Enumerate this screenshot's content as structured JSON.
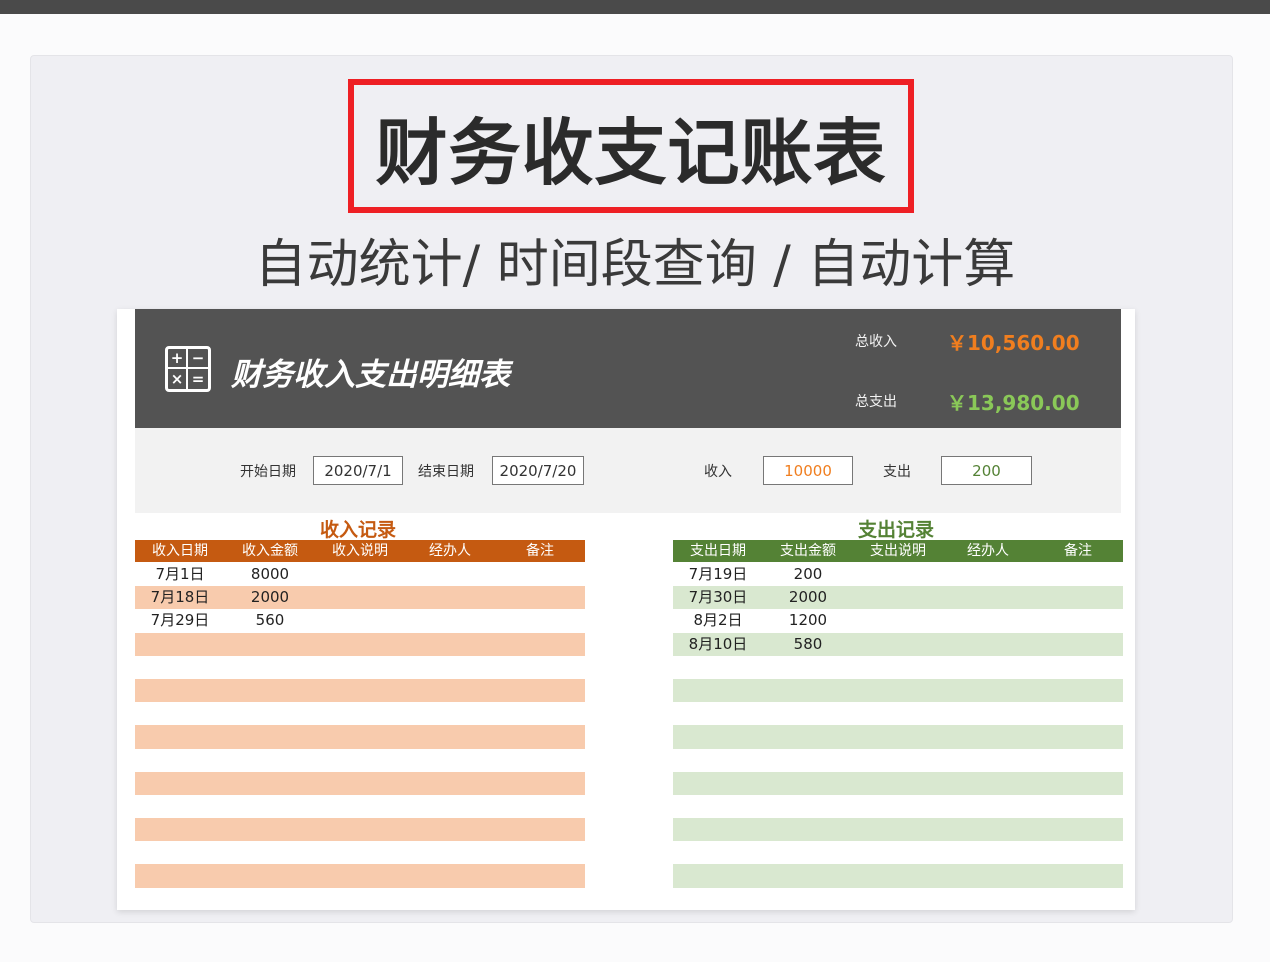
{
  "poster": {
    "title": "财务收支记账表",
    "subtitle": "自动统计/ 时间段查询 / 自动计算",
    "accent_red": "#ee1f24"
  },
  "sheet": {
    "title": "财务收入支出明细表",
    "icon": "calculator-icon",
    "calc_symbols": [
      "+",
      "−",
      "×",
      "="
    ],
    "summary": {
      "income_label": "总收入",
      "income_value": "￥10,560.00",
      "income_color": "#f07e1f",
      "expense_label": "总支出",
      "expense_value": "￥13,980.00",
      "expense_color": "#8ac858"
    },
    "filter": {
      "start_label": "开始日期",
      "start_value": "2020/7/1",
      "end_label": "结束日期",
      "end_value": "2020/7/20",
      "income_label": "收入",
      "income_value": "10000",
      "expense_label": "支出",
      "expense_value": "200"
    }
  },
  "income": {
    "title": "收入记录",
    "color": "#c55a11",
    "columns": [
      "收入日期",
      "收入金额",
      "收入说明",
      "经办人",
      "备注"
    ],
    "rows": [
      [
        "7月1日",
        "8000",
        "",
        "",
        ""
      ],
      [
        "7月18日",
        "2000",
        "",
        "",
        ""
      ],
      [
        "7月29日",
        "560",
        "",
        "",
        ""
      ],
      [
        "",
        "",
        "",
        "",
        ""
      ],
      [
        "",
        "",
        "",
        "",
        ""
      ],
      [
        "",
        "",
        "",
        "",
        ""
      ],
      [
        "",
        "",
        "",
        "",
        ""
      ],
      [
        "",
        "",
        "",
        "",
        ""
      ],
      [
        "",
        "",
        "",
        "",
        ""
      ],
      [
        "",
        "",
        "",
        "",
        ""
      ],
      [
        "",
        "",
        "",
        "",
        ""
      ],
      [
        "",
        "",
        "",
        "",
        ""
      ],
      [
        "",
        "",
        "",
        "",
        ""
      ],
      [
        "",
        "",
        "",
        "",
        ""
      ]
    ]
  },
  "expense": {
    "title": "支出记录",
    "color": "#548235",
    "columns": [
      "支出日期",
      "支出金额",
      "支出说明",
      "经办人",
      "备注"
    ],
    "rows": [
      [
        "7月19日",
        "200",
        "",
        "",
        ""
      ],
      [
        "7月30日",
        "2000",
        "",
        "",
        ""
      ],
      [
        "8月2日",
        "1200",
        "",
        "",
        ""
      ],
      [
        "8月10日",
        "580",
        "",
        "",
        ""
      ],
      [
        "",
        "",
        "",
        "",
        ""
      ],
      [
        "",
        "",
        "",
        "",
        ""
      ],
      [
        "",
        "",
        "",
        "",
        ""
      ],
      [
        "",
        "",
        "",
        "",
        ""
      ],
      [
        "",
        "",
        "",
        "",
        ""
      ],
      [
        "",
        "",
        "",
        "",
        ""
      ],
      [
        "",
        "",
        "",
        "",
        ""
      ],
      [
        "",
        "",
        "",
        "",
        ""
      ],
      [
        "",
        "",
        "",
        "",
        ""
      ],
      [
        "",
        "",
        "",
        "",
        ""
      ]
    ]
  }
}
